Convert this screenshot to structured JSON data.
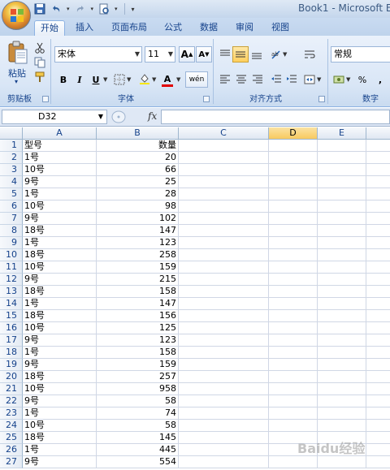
{
  "app": {
    "title": "Book1 - Microsoft Ex"
  },
  "ribbon": {
    "tabs": [
      {
        "label": "开始",
        "active": true
      },
      {
        "label": "插入",
        "active": false
      },
      {
        "label": "页面布局",
        "active": false
      },
      {
        "label": "公式",
        "active": false
      },
      {
        "label": "数据",
        "active": false
      },
      {
        "label": "审阅",
        "active": false
      },
      {
        "label": "视图",
        "active": false
      }
    ],
    "clipboard": {
      "paste_label": "粘贴",
      "group_label": "剪贴板"
    },
    "font": {
      "name": "宋体",
      "size": "11",
      "bold": "B",
      "italic": "I",
      "underline": "U",
      "grow": "A",
      "shrink": "A",
      "font_color_glyph": "A",
      "phonetic_glyph": "wén",
      "group_label": "字体"
    },
    "alignment": {
      "group_label": "对齐方式"
    },
    "number": {
      "format": "常规",
      "percent": "%",
      "comma": ",",
      "group_label": "数字"
    }
  },
  "formula_bar": {
    "name_box": "D32",
    "fx_label": "fx",
    "formula": ""
  },
  "sheet": {
    "columns": [
      "A",
      "B",
      "C",
      "D",
      "E"
    ],
    "selected_column": "D",
    "rows": [
      {
        "n": "1",
        "a": "型号",
        "b": "数量"
      },
      {
        "n": "2",
        "a": "1号",
        "b": "20"
      },
      {
        "n": "3",
        "a": "10号",
        "b": "66"
      },
      {
        "n": "4",
        "a": "9号",
        "b": "25"
      },
      {
        "n": "5",
        "a": "1号",
        "b": "28"
      },
      {
        "n": "6",
        "a": "10号",
        "b": "98"
      },
      {
        "n": "7",
        "a": "9号",
        "b": "102"
      },
      {
        "n": "8",
        "a": "18号",
        "b": "147"
      },
      {
        "n": "9",
        "a": "1号",
        "b": "123"
      },
      {
        "n": "10",
        "a": "18号",
        "b": "258"
      },
      {
        "n": "11",
        "a": "10号",
        "b": "159"
      },
      {
        "n": "12",
        "a": "9号",
        "b": "215"
      },
      {
        "n": "13",
        "a": "18号",
        "b": "158"
      },
      {
        "n": "14",
        "a": "1号",
        "b": "147"
      },
      {
        "n": "15",
        "a": "18号",
        "b": "156"
      },
      {
        "n": "16",
        "a": "10号",
        "b": "125"
      },
      {
        "n": "17",
        "a": "9号",
        "b": "123"
      },
      {
        "n": "18",
        "a": "1号",
        "b": "158"
      },
      {
        "n": "19",
        "a": "9号",
        "b": "159"
      },
      {
        "n": "20",
        "a": "18号",
        "b": "257"
      },
      {
        "n": "21",
        "a": "10号",
        "b": "958"
      },
      {
        "n": "22",
        "a": "9号",
        "b": "58"
      },
      {
        "n": "23",
        "a": "1号",
        "b": "74"
      },
      {
        "n": "24",
        "a": "10号",
        "b": "58"
      },
      {
        "n": "25",
        "a": "18号",
        "b": "145"
      },
      {
        "n": "26",
        "a": "1号",
        "b": "445"
      },
      {
        "n": "27",
        "a": "9号",
        "b": "554"
      }
    ]
  },
  "watermark": "Baidu经验"
}
